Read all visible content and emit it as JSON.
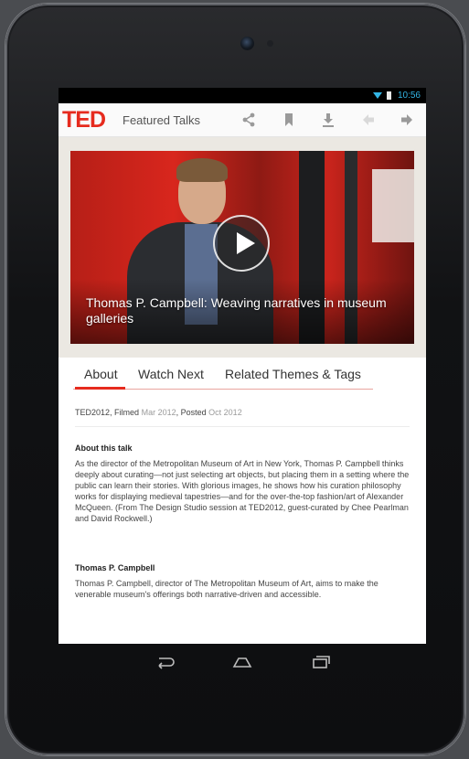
{
  "status_bar": {
    "time": "10:56"
  },
  "action_bar": {
    "logo": "TED",
    "section_title": "Featured Talks",
    "icons": [
      "share-icon",
      "bookmark-icon",
      "download-icon",
      "back-arrow-icon",
      "forward-arrow-icon"
    ]
  },
  "video": {
    "title": "Thomas P. Campbell: Weaving narratives in museum galleries"
  },
  "tabs": [
    {
      "label": "About",
      "active": true
    },
    {
      "label": "Watch Next",
      "active": false
    },
    {
      "label": "Related Themes & Tags",
      "active": false
    }
  ],
  "meta": {
    "event": "TED2012",
    "filmed_label": "Filmed",
    "filmed_value": "Mar 2012",
    "posted_label": "Posted",
    "posted_value": "Oct 2012"
  },
  "about": {
    "heading": "About this talk",
    "text": "As the director of the Metropolitan Museum of Art in New York, Thomas P. Campbell thinks deeply about curating—not just selecting art objects, but placing them in a setting where the public can learn their stories. With glorious images, he shows how his curation philosophy works for displaying medieval tapestries—and for the over-the-top fashion/art of Alexander McQueen. (From The Design Studio session at TED2012, guest-curated by Chee Pearlman and David Rockwell.)"
  },
  "speaker": {
    "heading": "Thomas P. Campbell",
    "text": "Thomas P. Campbell, director of The Metropolitan Museum of Art, aims to make the venerable museum's offerings both narrative-driven and accessible."
  },
  "nav_bar": {
    "icons": [
      "back-nav-icon",
      "home-nav-icon",
      "recent-apps-icon"
    ]
  },
  "colors": {
    "brand": "#e62b1e",
    "status_accent": "#33b5e5"
  }
}
